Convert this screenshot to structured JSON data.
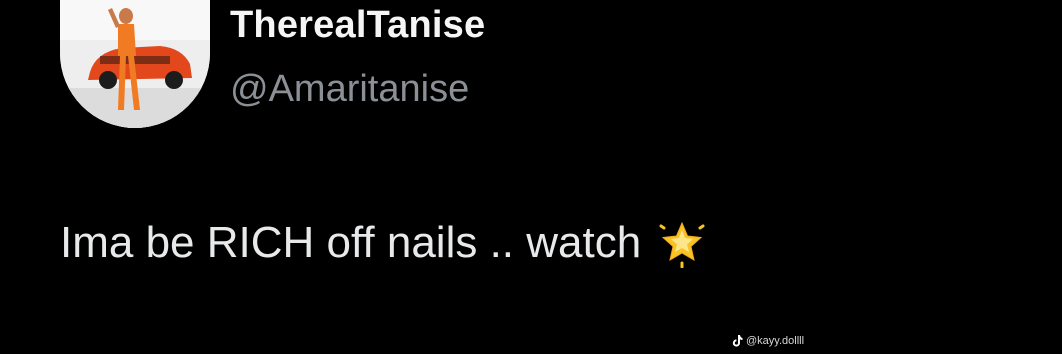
{
  "tweet": {
    "display_name": "TherealTanise",
    "handle": "@Amaritanise",
    "text": "Ima be RICH off nails .. watch",
    "emoji_icon": "glowing-star-icon",
    "avatar_icon": "profile-photo-orange-car"
  },
  "watermark": {
    "icon": "tiktok-icon",
    "text": "@kayy.dollll"
  },
  "colors": {
    "background": "#000000",
    "name": "#f5f5f5",
    "handle": "#8b9096",
    "text": "#e7e9ea",
    "star": "#f7c325"
  }
}
